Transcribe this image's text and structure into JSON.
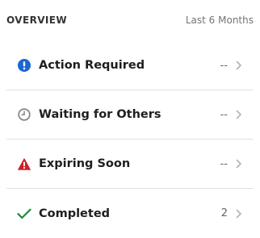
{
  "overview": {
    "title": "OVERVIEW",
    "range": "Last 6 Months"
  },
  "colors": {
    "action": "#1a66d2",
    "waiting": "#8a8a8a",
    "expiring": "#cc2229",
    "completed": "#1e8a3c",
    "chevron": "#b3b3b3"
  },
  "rows": [
    {
      "label": "Action Required",
      "count": "--",
      "icon": "exclamation-circle-icon"
    },
    {
      "label": "Waiting for Others",
      "count": "--",
      "icon": "clock-icon"
    },
    {
      "label": "Expiring Soon",
      "count": "--",
      "icon": "warning-triangle-icon"
    },
    {
      "label": "Completed",
      "count": "2",
      "icon": "checkmark-icon"
    }
  ]
}
